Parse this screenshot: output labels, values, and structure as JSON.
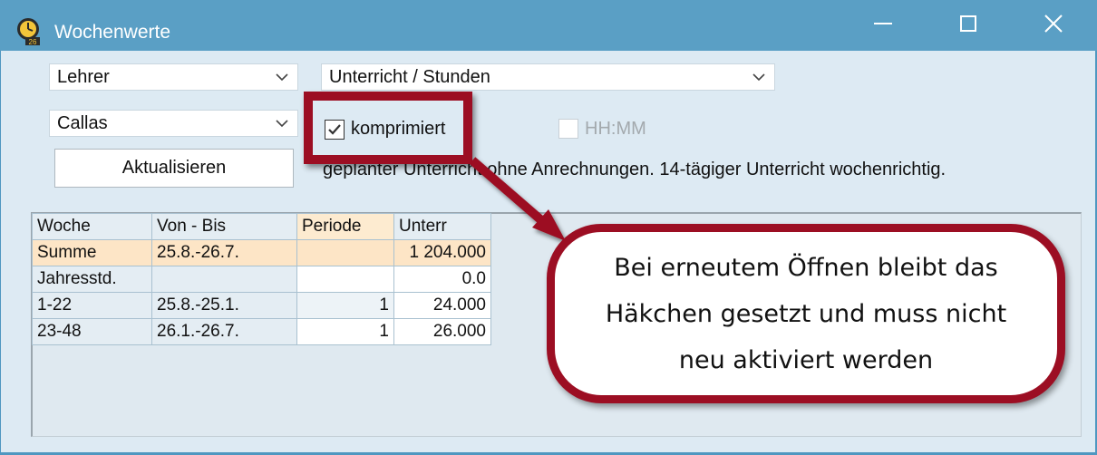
{
  "window": {
    "title": "Wochenwerte",
    "icon_badge": "26"
  },
  "icons": {
    "app": "clock-app-icon",
    "minimize": "minimize-icon",
    "maximize": "maximize-icon",
    "close": "close-icon",
    "dropdown": "chevron-down-icon",
    "check": "checkmark-icon"
  },
  "filters": {
    "type_select": "Lehrer",
    "subject_select": "Unterricht / Stunden",
    "person_select": "Callas"
  },
  "options": {
    "komprimiert_label": "komprimiert",
    "komprimiert_checked": true,
    "hhmm_label": "HH:MM",
    "hhmm_checked": false,
    "hhmm_enabled": false
  },
  "actions": {
    "refresh_label": "Aktualisieren"
  },
  "info_text": "geplanter Unterricht ohne Anrechnungen. 14-tägiger Unterricht wochenrichtig.",
  "table": {
    "headers": [
      "Woche",
      "Von - Bis",
      "Periode",
      "Unterr"
    ],
    "rows": [
      {
        "woche": "Summe",
        "von_bis": "25.8.-26.7.",
        "periode": "",
        "unterr": "1 204.000"
      },
      {
        "woche": "Jahresstd.",
        "von_bis": "",
        "periode": "",
        "unterr": "0.0"
      },
      {
        "woche": "1-22",
        "von_bis": "25.8.-25.1.",
        "periode": "1",
        "unterr": "24.000"
      },
      {
        "woche": "23-48",
        "von_bis": "26.1.-26.7.",
        "periode": "1",
        "unterr": "26.000"
      }
    ]
  },
  "annotation": {
    "callout_line1": "Bei erneutem Öffnen bleibt das",
    "callout_line2": "Häkchen gesetzt und muss nicht",
    "callout_line3": "neu aktiviert werden",
    "color": "#9c0e23"
  },
  "colors": {
    "titlebar": "#5a9fc5",
    "client_bg": "#ddeaf3",
    "sum_row": "#fde5c6",
    "periode_header": "#fdebd0"
  }
}
